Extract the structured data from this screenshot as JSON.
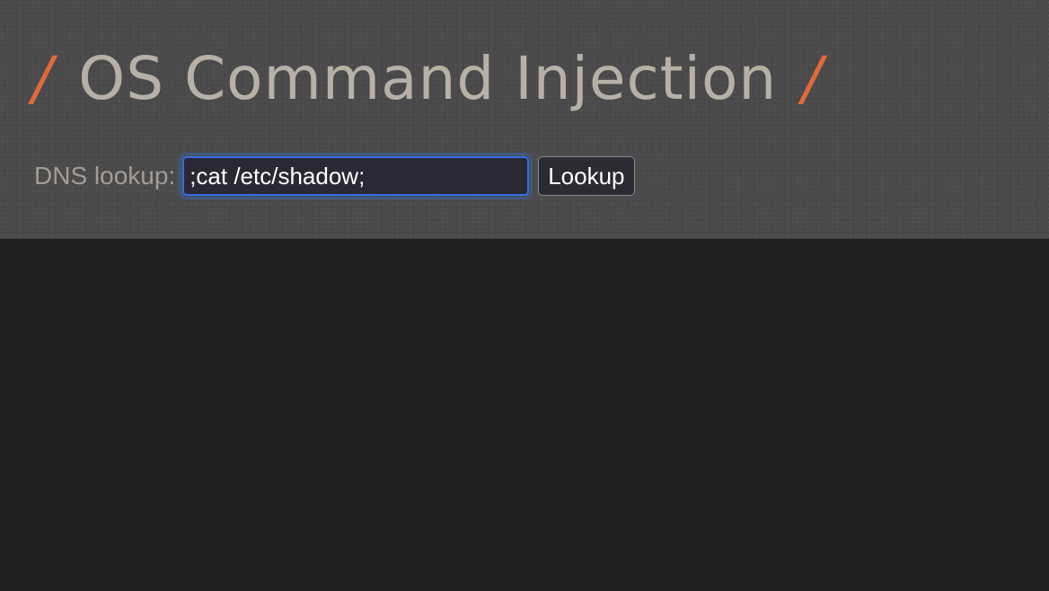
{
  "header": {
    "title": "OS Command Injection",
    "slash_left": "/",
    "slash_right": "/",
    "accent_color": "#e06a3c"
  },
  "form": {
    "label": "DNS lookup:",
    "input_value": ";cat /etc/shadow;",
    "button_label": "Lookup"
  }
}
